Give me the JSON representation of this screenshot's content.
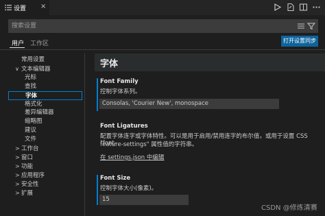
{
  "tab": {
    "icon": "settings-list-icon",
    "label": "设置",
    "close": "×"
  },
  "actions": [
    "run-icon",
    "open-json-icon",
    "split-editor-icon",
    "more-icon"
  ],
  "search": {
    "placeholder": "搜索设置",
    "icons": [
      "clear-filter-icon",
      "filter-icon"
    ]
  },
  "scopes": {
    "user": "用户",
    "workspace": "工作区"
  },
  "sync_button": "打开设置同步",
  "toc": [
    {
      "label": "常用设置",
      "depth": 0,
      "chevron": ""
    },
    {
      "label": "文本编辑器",
      "depth": 0,
      "chevron": "∨"
    },
    {
      "label": "光标",
      "depth": 1,
      "chevron": ""
    },
    {
      "label": "查找",
      "depth": 1,
      "chevron": ""
    },
    {
      "label": "字体",
      "depth": 1,
      "chevron": "",
      "selected": true
    },
    {
      "label": "格式化",
      "depth": 1,
      "chevron": ""
    },
    {
      "label": "差异编辑器",
      "depth": 1,
      "chevron": ""
    },
    {
      "label": "缩略图",
      "depth": 1,
      "chevron": ""
    },
    {
      "label": "建议",
      "depth": 1,
      "chevron": ""
    },
    {
      "label": "文件",
      "depth": 1,
      "chevron": ""
    },
    {
      "label": "工作台",
      "depth": 0,
      "chevron": ">"
    },
    {
      "label": "窗口",
      "depth": 0,
      "chevron": ">"
    },
    {
      "label": "功能",
      "depth": 0,
      "chevron": ">"
    },
    {
      "label": "应用程序",
      "depth": 0,
      "chevron": ">"
    },
    {
      "label": "安全性",
      "depth": 0,
      "chevron": ">"
    },
    {
      "label": "扩展",
      "depth": 0,
      "chevron": ">"
    }
  ],
  "section_header": "字体",
  "settings": {
    "font_family": {
      "title": "Font Family",
      "desc": "控制字体系列。",
      "value": "Consolas, 'Courier New', monospace"
    },
    "font_ligatures": {
      "title": "Font Ligatures",
      "desc_line1": "配置字体连字或字体特性。可以是用于启用/禁用连字的布尔值，或用于设置 CSS \"font-",
      "desc_line2": "feature-settings\" 属性值的字符串。",
      "link": "在 settings.json 中编辑"
    },
    "font_size": {
      "title": "Font Size",
      "desc": "控制字体大小(像素)。",
      "value": "15"
    }
  },
  "watermark": "CSDN @修炼清赛",
  "colors": {
    "accent": "#007fd4",
    "button": "#0e639c",
    "background": "#1e1e1e"
  }
}
